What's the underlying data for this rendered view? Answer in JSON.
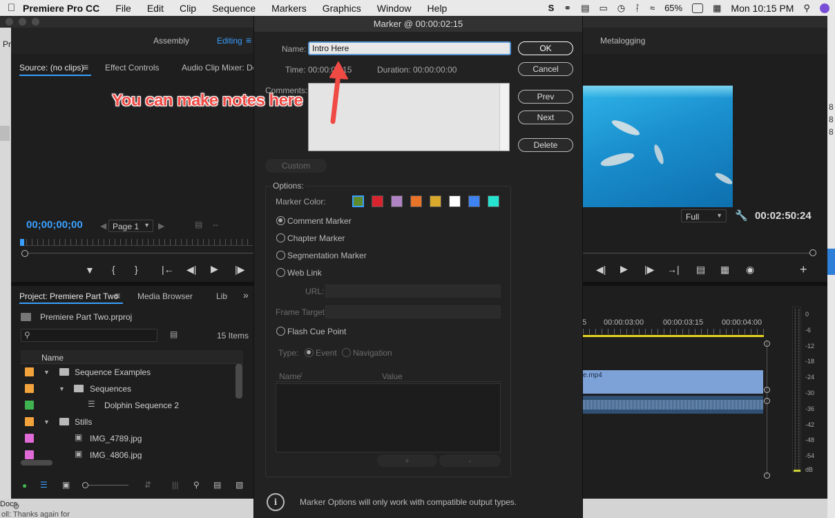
{
  "menubar": {
    "app": "Premiere Pro CC",
    "items": [
      "File",
      "Edit",
      "Clip",
      "Sequence",
      "Markers",
      "Graphics",
      "Window",
      "Help"
    ],
    "battery": "65%",
    "clock": "Mon 10:15 PM"
  },
  "workspaces": {
    "assembly": "Assembly",
    "editing": "Editing",
    "metalogging": "Metalogging"
  },
  "source_panel": {
    "tab_source": "Source: (no clips)",
    "tab_effects": "Effect Controls",
    "tab_mixer": "Audio Clip Mixer: Dolp",
    "timecode": "00;00;00;00",
    "page_select": "Page 1"
  },
  "program_panel": {
    "zoom": "Full",
    "timecode": "00:02:50:24"
  },
  "project_panel": {
    "tab_project": "Project: Premiere Part Two",
    "tab_media": "Media Browser",
    "tab_lib": "Lib",
    "project_file": "Premiere Part Two.prproj",
    "item_count": "15 Items",
    "column_name": "Name",
    "rows": [
      {
        "label": "Sequence Examples",
        "color": "#f2a33c"
      },
      {
        "label": "Sequences",
        "color": "#f2a33c"
      },
      {
        "label": "Dolphin Sequence 2",
        "color": "#3fb34f"
      },
      {
        "label": "Stills",
        "color": "#f2a33c"
      },
      {
        "label": "IMG_4789.jpg",
        "color": "#e06ad6"
      },
      {
        "label": "IMG_4806.jpg",
        "color": "#e06ad6"
      }
    ]
  },
  "timeline": {
    "ruler": [
      "00:00:03:00",
      "00:00:03:15",
      "00:00:04:00"
    ],
    "clip_name": "e.mp4",
    "meter_labels": [
      "0",
      "-6",
      "-12",
      "-18",
      "-24",
      "-30",
      "-36",
      "-42",
      "-48",
      "-54",
      "dB"
    ],
    "edge_digits": [
      "8",
      "8",
      "8"
    ]
  },
  "bottom_left": {
    "docs": "Docs",
    "thanks": "oll: Thanks again for"
  },
  "dialog": {
    "title": "Marker @ 00:00:02:15",
    "name_label": "Name:",
    "name_value": "Intro Here",
    "time_label": "Time:",
    "time_value": "00:00:02:15",
    "duration_label": "Duration:",
    "duration_value": "00:00:00:00",
    "comments_label": "Comments:",
    "buttons": {
      "ok": "OK",
      "cancel": "Cancel",
      "prev": "Prev",
      "next": "Next",
      "delete": "Delete",
      "custom": "Custom",
      "add": "+",
      "remove": "-"
    },
    "options_label": "Options:",
    "marker_color_label": "Marker Color:",
    "colors": [
      "#5d8a2d",
      "#d8242e",
      "#b084c4",
      "#e8742a",
      "#d8a92a",
      "#ffffff",
      "#3f83f2",
      "#26e3cf"
    ],
    "marker_types": [
      "Comment Marker",
      "Chapter Marker",
      "Segmentation Marker",
      "Web Link"
    ],
    "selected_type": "Comment Marker",
    "url_label": "URL:",
    "frame_target_label": "Frame Target:",
    "flash_cue": "Flash Cue Point",
    "type_label": "Type:",
    "type_event": "Event",
    "type_navigation": "Navigation",
    "table_name": "Name",
    "table_value": "Value",
    "info_text": "Marker Options will only work with compatible output types."
  },
  "annotation": "You can make notes here"
}
